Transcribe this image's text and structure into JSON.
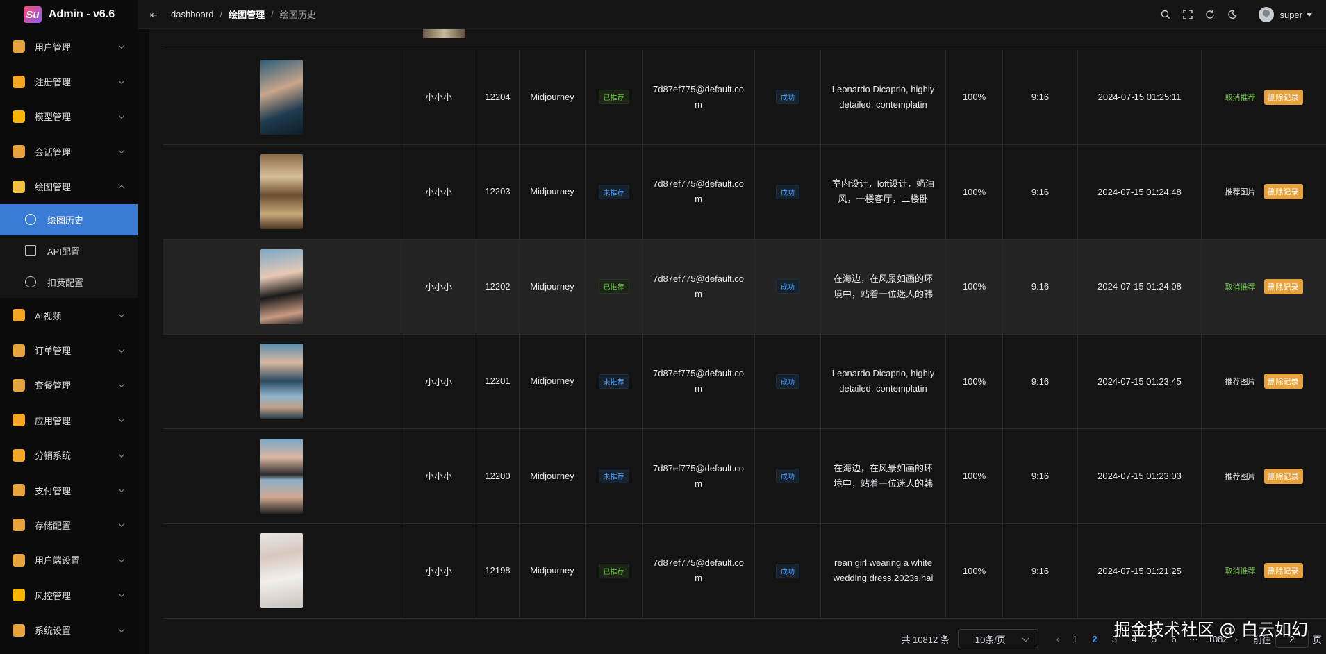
{
  "brand": {
    "logo_text": "Su",
    "title": "Admin - v6.6"
  },
  "header": {
    "breadcrumb": [
      "dashboard",
      "绘图管理",
      "绘图历史"
    ],
    "user": "super"
  },
  "sidebar": {
    "items": [
      {
        "label": "用户管理",
        "color": "#e6a23c"
      },
      {
        "label": "注册管理",
        "color": "#f5a623"
      },
      {
        "label": "模型管理",
        "color": "#f7b500"
      },
      {
        "label": "会话管理",
        "color": "#e6a23c"
      },
      {
        "label": "绘图管理",
        "color": "#f0c040",
        "expanded": true
      },
      {
        "label": "AI视频",
        "color": "#f5a623"
      },
      {
        "label": "订单管理",
        "color": "#e6a23c"
      },
      {
        "label": "套餐管理",
        "color": "#e6a23c"
      },
      {
        "label": "应用管理",
        "color": "#f5a623"
      },
      {
        "label": "分销系统",
        "color": "#f5a623"
      },
      {
        "label": "支付管理",
        "color": "#e6a23c"
      },
      {
        "label": "存储配置",
        "color": "#e6a23c"
      },
      {
        "label": "用户端设置",
        "color": "#e6a23c"
      },
      {
        "label": "风控管理",
        "color": "#f7b500"
      },
      {
        "label": "系统设置",
        "color": "#e6a23c"
      }
    ],
    "sub_items": [
      "绘图历史",
      "API配置",
      "扣费配置"
    ]
  },
  "table": {
    "rows": [
      {
        "user": "小小小",
        "id": "12204",
        "model": "Midjourney",
        "recommend": "已推荐",
        "recommended": true,
        "email": "7d87ef775@default.com",
        "status": "成功",
        "prompt": "Leonardo Dicaprio, highly detailed, contemplatin",
        "progress": "100%",
        "ratio": "9:16",
        "time": "2024-07-15 01:25:11",
        "action": "取消推荐",
        "delete": "删除记录",
        "thumb": "linear-gradient(160deg,#2b5e7a,#c9a58a 40%,#1e3b4f 70%,#0f1d26)"
      },
      {
        "user": "小小小",
        "id": "12203",
        "model": "Midjourney",
        "recommend": "未推荐",
        "recommended": false,
        "email": "7d87ef775@default.com",
        "status": "成功",
        "prompt": "室内设计，loft设计，奶油风，一楼客厅，二楼卧室，",
        "progress": "100%",
        "ratio": "9:16",
        "time": "2024-07-15 01:24:48",
        "action": "推荐图片",
        "delete": "删除记录",
        "thumb": "linear-gradient(180deg,#8a6a44,#d8c09a 30%,#6b4e30 55%,#c9a878 80%,#4a3522)"
      },
      {
        "user": "小小小",
        "id": "12202",
        "model": "Midjourney",
        "recommend": "已推荐",
        "recommended": true,
        "email": "7d87ef775@default.com",
        "status": "成功",
        "prompt": "在海边，在风景如画的环境中，站着一位迷人的韩",
        "progress": "100%",
        "ratio": "9:16",
        "time": "2024-07-15 01:24:08",
        "action": "取消推荐",
        "delete": "删除记录",
        "thumb": "linear-gradient(170deg,#7aa8c8,#e8c9b5 35%,#1a1a1a 60%,#c99a82 85%,#2b2b2b)"
      },
      {
        "user": "小小小",
        "id": "12201",
        "model": "Midjourney",
        "recommend": "未推荐",
        "recommended": false,
        "email": "7d87ef775@default.com",
        "status": "成功",
        "prompt": "Leonardo Dicaprio, highly detailed, contemplatin",
        "progress": "100%",
        "ratio": "9:16",
        "time": "2024-07-15 01:23:45",
        "action": "推荐图片",
        "delete": "删除记录",
        "thumb": "linear-gradient(180deg,#5a8fb0,#d9b8a0 25%,#2a4a60 50%,#8fb5cc 70%,#c0a088 85%,#243b4a)"
      },
      {
        "user": "小小小",
        "id": "12200",
        "model": "Midjourney",
        "recommend": "未推荐",
        "recommended": false,
        "email": "7d87ef775@default.com",
        "status": "成功",
        "prompt": "在海边，在风景如画的环境中，站着一位迷人的韩",
        "progress": "100%",
        "ratio": "9:16",
        "time": "2024-07-15 01:23:03",
        "action": "推荐图片",
        "delete": "删除记录",
        "thumb": "linear-gradient(180deg,#7aa8c8,#d9b5a0 25%,#2b2b2b 48%,#8fb0c8 55%,#d0a890 78%,#222)"
      },
      {
        "user": "小小小",
        "id": "12198",
        "model": "Midjourney",
        "recommend": "已推荐",
        "recommended": true,
        "email": "7d87ef775@default.com",
        "status": "成功",
        "prompt": "rean girl wearing a white wedding dress,2023s,hai",
        "progress": "100%",
        "ratio": "9:16",
        "time": "2024-07-15 01:21:25",
        "action": "取消推荐",
        "delete": "删除记录",
        "thumb": "linear-gradient(170deg,#e8e6e4,#d8c8c0 30%,#f2efec 60%,#c9c2bd)"
      }
    ]
  },
  "pagination": {
    "total": "共 10812 条",
    "page_size": "10条/页",
    "pages": [
      "1",
      "2",
      "3",
      "4",
      "5",
      "6"
    ],
    "current": "2",
    "ellipsis": "···",
    "last": "1082",
    "goto_label": "前往",
    "goto_value": "2",
    "goto_suffix": "页"
  },
  "watermark": "掘金技术社区 @ 白云如幻"
}
